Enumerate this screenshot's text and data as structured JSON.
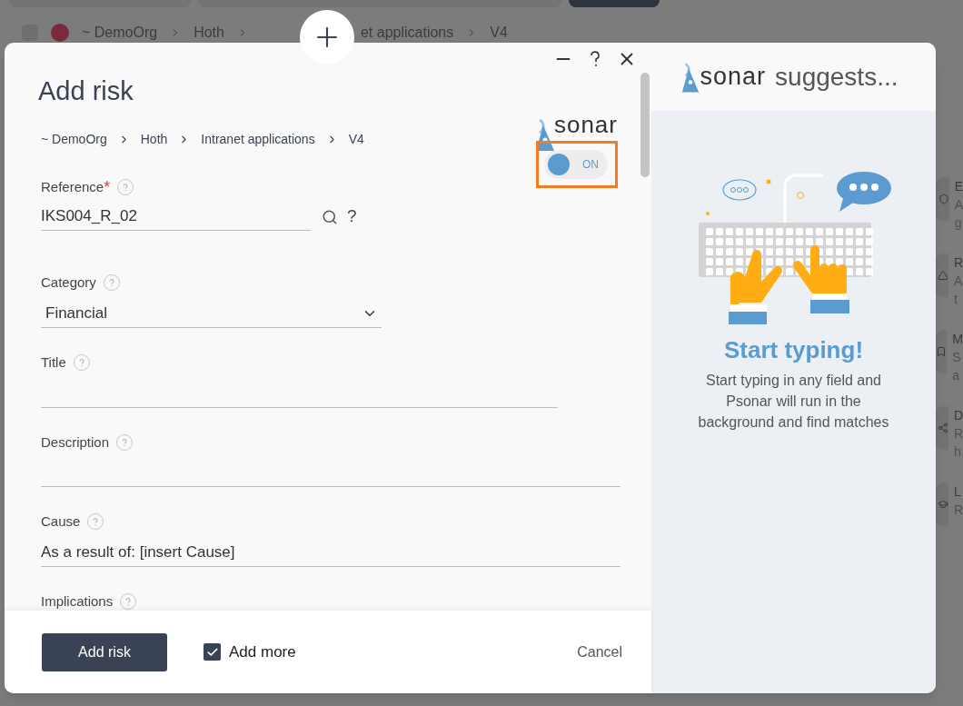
{
  "background": {
    "breadcrumb": [
      "~ DemoOrg",
      "Hoth",
      "et applications",
      "V4"
    ],
    "side_items": [
      {
        "title": "E",
        "lines": [
          "A",
          "g"
        ]
      },
      {
        "title": "R",
        "lines": [
          "A",
          "t"
        ]
      },
      {
        "title": "M",
        "lines": [
          "S",
          "a"
        ]
      },
      {
        "title": "D",
        "lines": [
          "R",
          "h"
        ]
      },
      {
        "title": "L",
        "lines": [
          "R"
        ]
      }
    ]
  },
  "dialog": {
    "title": "Add risk",
    "breadcrumb": [
      "~ DemoOrg",
      "Hoth",
      "Intranet applications",
      "V4"
    ],
    "psonar": {
      "logo": "sonar",
      "toggle": {
        "label": "ON",
        "on": true
      }
    },
    "fields": [
      {
        "kind": "search",
        "label": "Reference",
        "required_mark": "*",
        "value": "IKS004_R_02",
        "help": "?"
      },
      {
        "kind": "select",
        "label": "Category",
        "value": "Financial"
      },
      {
        "kind": "text",
        "label": "Title"
      },
      {
        "kind": "text",
        "label": "Description"
      },
      {
        "kind": "text",
        "label": "Cause",
        "value": "As a result of: [insert Cause]"
      },
      {
        "kind": "label",
        "label": "Implications"
      }
    ],
    "footer": {
      "submit": "Add risk",
      "add_more": {
        "label": "Add more",
        "checked": true
      },
      "cancel": "Cancel"
    }
  },
  "suggest_panel": {
    "logo": "sonar",
    "title": "suggests...",
    "heading": "Start typing!",
    "text": "Start typing in any field and Psonar will run in the background and find matches"
  }
}
